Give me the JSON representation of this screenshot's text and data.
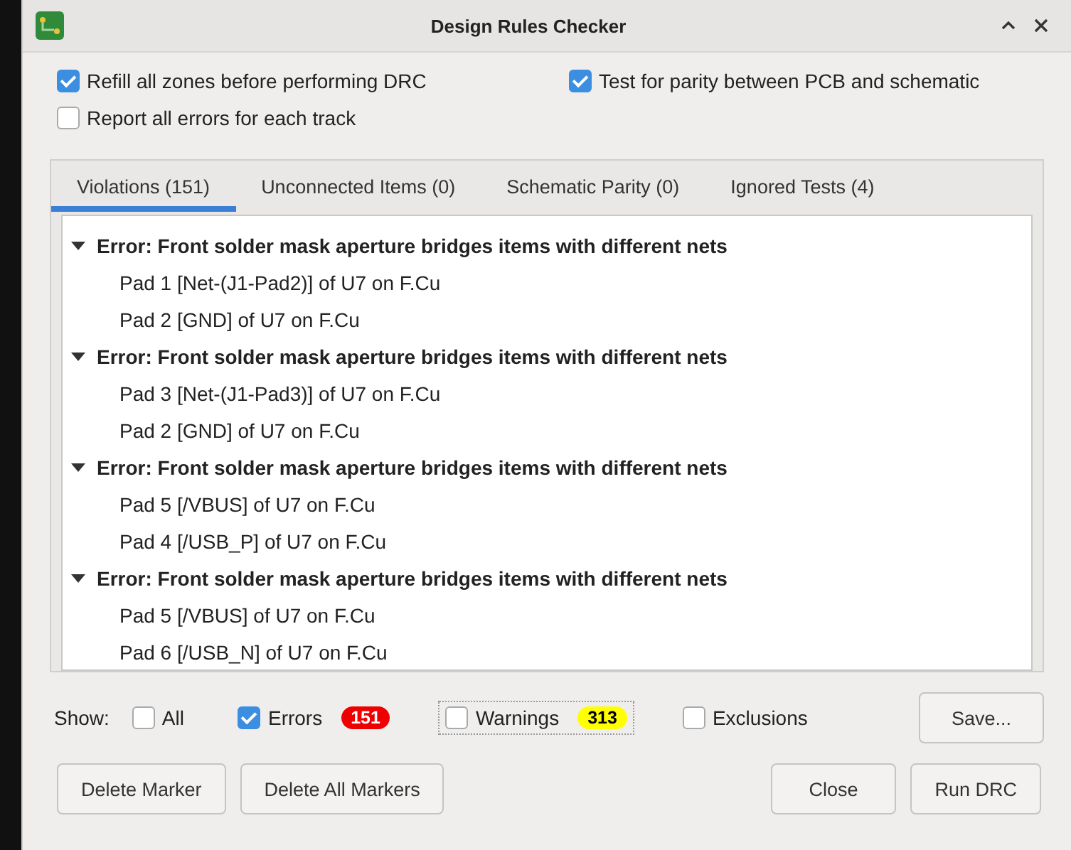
{
  "window": {
    "title": "Design Rules Checker"
  },
  "options": [
    {
      "label": "Refill all zones before performing DRC",
      "checked": true
    },
    {
      "label": "Test for parity between PCB and schematic",
      "checked": true
    },
    {
      "label": "Report all errors for each track",
      "checked": false
    }
  ],
  "tabs": [
    {
      "label": "Violations (151)",
      "selected": true
    },
    {
      "label": "Unconnected Items (0)",
      "selected": false
    },
    {
      "label": "Schematic Parity (0)",
      "selected": false
    },
    {
      "label": "Ignored Tests (4)",
      "selected": false
    }
  ],
  "violations": [
    {
      "label": "Error: Front solder mask aperture bridges items with different nets",
      "expanded": true,
      "children": [
        {
          "label": "Pad 1 [Net-(J1-Pad2)] of U7 on F.Cu"
        },
        {
          "label": "Pad 2 [GND] of U7 on F.Cu"
        }
      ]
    },
    {
      "label": "Error: Front solder mask aperture bridges items with different nets",
      "expanded": true,
      "children": [
        {
          "label": "Pad 3 [Net-(J1-Pad3)] of U7 on F.Cu"
        },
        {
          "label": "Pad 2 [GND] of U7 on F.Cu"
        }
      ]
    },
    {
      "label": "Error: Front solder mask aperture bridges items with different nets",
      "expanded": true,
      "children": [
        {
          "label": "Pad 5 [/VBUS] of U7 on F.Cu"
        },
        {
          "label": "Pad 4 [/USB_P] of U7 on F.Cu"
        }
      ]
    },
    {
      "label": "Error: Front solder mask aperture bridges items with different nets",
      "expanded": true,
      "children": [
        {
          "label": "Pad 5 [/VBUS] of U7 on F.Cu"
        },
        {
          "label": "Pad 6 [/USB_N] of U7 on F.Cu"
        }
      ]
    }
  ],
  "show": {
    "label": "Show:",
    "filters": [
      {
        "label": "All",
        "checked": false
      },
      {
        "label": "Errors",
        "checked": true,
        "count": "151",
        "color": "#ee0000"
      },
      {
        "label": "Warnings",
        "checked": false,
        "count": "313",
        "color": "#ffff00"
      },
      {
        "label": "Exclusions",
        "checked": false
      }
    ]
  },
  "buttons": {
    "save": "Save...",
    "delete_marker": "Delete Marker",
    "delete_all": "Delete All Markers",
    "close": "Close",
    "run": "Run DRC"
  }
}
